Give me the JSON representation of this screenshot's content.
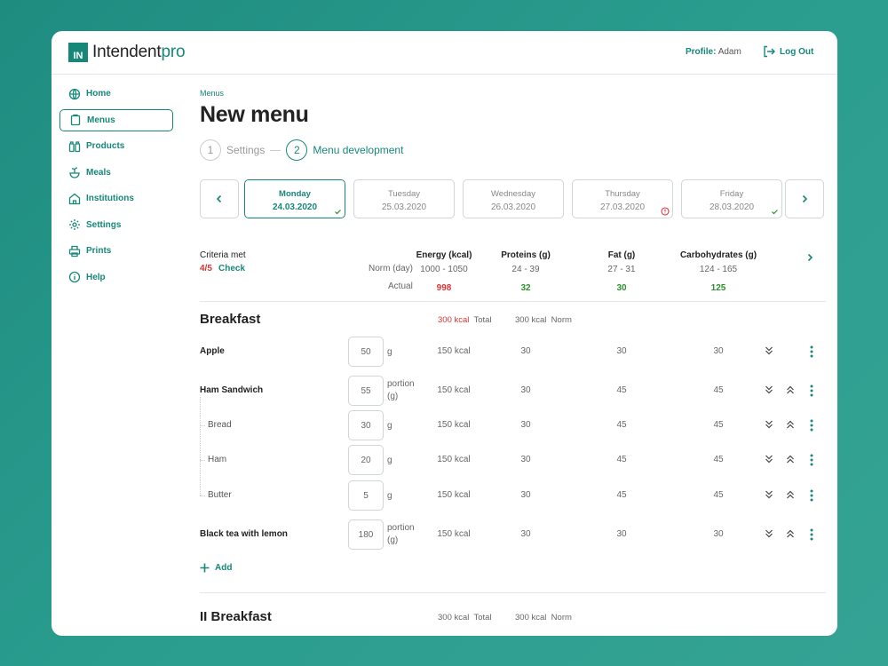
{
  "brand": {
    "mark": "IN",
    "name": "Intendent",
    "suffix": "pro"
  },
  "header": {
    "profile_label": "Profile:",
    "profile_name": "Adam",
    "logout": "Log Out"
  },
  "sidebar": {
    "items": [
      {
        "label": "Home",
        "icon": "globe-icon",
        "active": false
      },
      {
        "label": "Menus",
        "icon": "clipboard-icon",
        "active": true
      },
      {
        "label": "Products",
        "icon": "bottles-icon",
        "active": false
      },
      {
        "label": "Meals",
        "icon": "fruit-icon",
        "active": false
      },
      {
        "label": "Institutions",
        "icon": "building-icon",
        "active": false
      },
      {
        "label": "Settings",
        "icon": "gear-icon",
        "active": false
      },
      {
        "label": "Prints",
        "icon": "printer-icon",
        "active": false
      },
      {
        "label": "Help",
        "icon": "info-icon",
        "active": false
      }
    ]
  },
  "page": {
    "breadcrumb": "Menus",
    "title": "New menu",
    "steps": [
      {
        "num": "1",
        "label": "Settings",
        "active": false
      },
      {
        "num": "2",
        "label": "Menu development",
        "active": true
      }
    ]
  },
  "days": [
    {
      "name": "Monday",
      "date": "24.03.2020",
      "status": "ok",
      "active": true
    },
    {
      "name": "Tuesday",
      "date": "25.03.2020",
      "status": "",
      "active": false
    },
    {
      "name": "Wednesday",
      "date": "26.03.2020",
      "status": "",
      "active": false
    },
    {
      "name": "Thursday",
      "date": "27.03.2020",
      "status": "warning",
      "active": false
    },
    {
      "name": "Friday",
      "date": "28.03.2020",
      "status": "ok",
      "active": false
    }
  ],
  "criteria": {
    "title": "Criteria met",
    "score": "4/5",
    "check": "Check",
    "norm_label": "Norm (day)",
    "actual_label": "Actual",
    "columns": [
      {
        "header": "Energy (kcal)",
        "norm": "1000 - 1050",
        "actual": "998",
        "status": "red"
      },
      {
        "header": "Proteins (g)",
        "norm": "24 - 39",
        "actual": "32",
        "status": "green"
      },
      {
        "header": "Fat (g)",
        "norm": "27 - 31",
        "actual": "30",
        "status": "green"
      },
      {
        "header": "Carbohydrates (g)",
        "norm": "124 - 165",
        "actual": "125",
        "status": "green"
      }
    ]
  },
  "breakfast": {
    "title": "Breakfast",
    "total_kcal": "300 kcal",
    "total_label": "Total",
    "norm_kcal": "300 kcal",
    "norm_label": "Norm",
    "rows": [
      {
        "name": "Apple",
        "qty": "50",
        "unit": "g",
        "kcal": "150 kcal",
        "proteins": "30",
        "fat": "30",
        "carbs": "30",
        "sub": false,
        "has_up": false
      },
      {
        "name": "Ham Sandwich",
        "qty": "55",
        "unit": "portion (g)",
        "kcal": "150 kcal",
        "proteins": "30",
        "fat": "45",
        "carbs": "45",
        "sub": false,
        "has_up": true
      },
      {
        "name": "Bread",
        "qty": "30",
        "unit": "g",
        "kcal": "150 kcal",
        "proteins": "30",
        "fat": "45",
        "carbs": "45",
        "sub": true,
        "has_up": true
      },
      {
        "name": "Ham",
        "qty": "20",
        "unit": "g",
        "kcal": "150 kcal",
        "proteins": "30",
        "fat": "45",
        "carbs": "45",
        "sub": true,
        "has_up": true
      },
      {
        "name": "Butter",
        "qty": "5",
        "unit": "g",
        "kcal": "150 kcal",
        "proteins": "30",
        "fat": "45",
        "carbs": "45",
        "sub": true,
        "has_up": true
      },
      {
        "name": "Black tea with lemon",
        "qty": "180",
        "unit": "portion (g)",
        "kcal": "150 kcal",
        "proteins": "30",
        "fat": "30",
        "carbs": "30",
        "sub": false,
        "has_up": true
      }
    ],
    "add_label": "Add"
  },
  "second_breakfast": {
    "title": "II Breakfast",
    "total_kcal": "300 kcal",
    "total_label": "Total",
    "norm_kcal": "300 kcal",
    "norm_label": "Norm"
  },
  "colors": {
    "accent": "#17877a",
    "error": "#d93636",
    "success": "#2d8f2d"
  }
}
